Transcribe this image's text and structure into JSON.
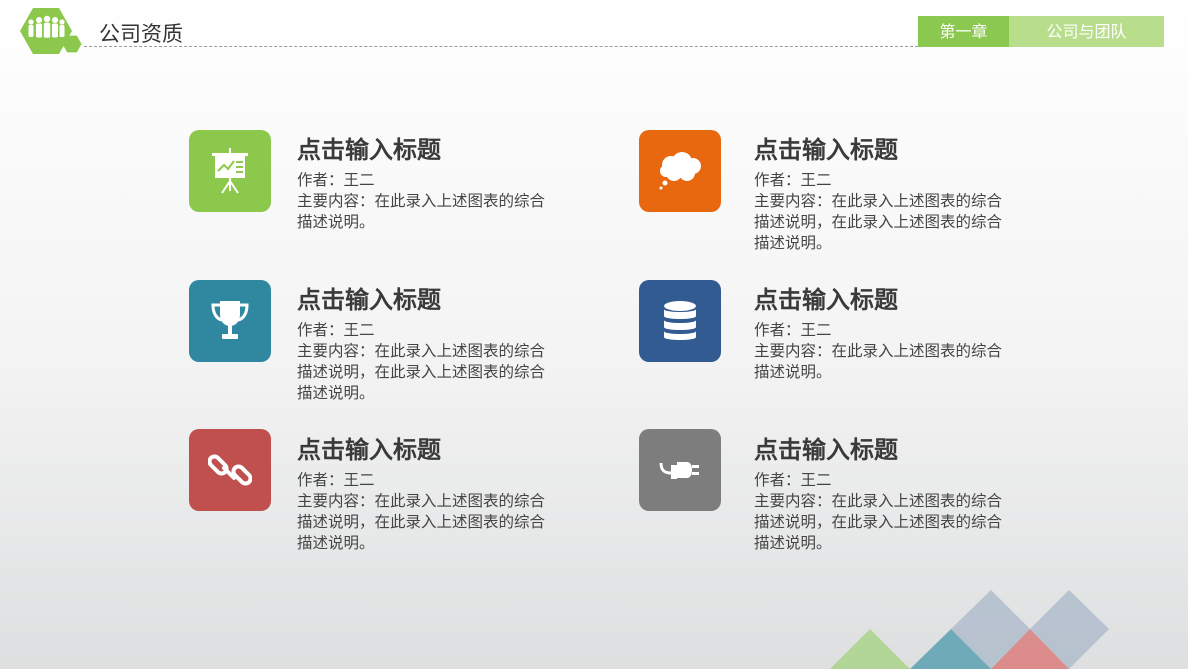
{
  "header": {
    "title": "公司资质",
    "chapter": "第一章",
    "chapter_name": "公司与团队"
  },
  "cards": [
    {
      "title": "点击输入标题",
      "author": "作者：王二",
      "desc": "主要内容：在此录入上述图表的综合描述说明。",
      "color": "#8cc84b",
      "icon": "presentation-board-icon"
    },
    {
      "title": "点击输入标题",
      "author": "作者：王二",
      "desc": "主要内容：在此录入上述图表的综合描述说明，在此录入上述图表的综合描述说明。",
      "color": "#e8680f",
      "icon": "thought-bubble-icon"
    },
    {
      "title": "点击输入标题",
      "author": "作者：王二",
      "desc": "主要内容：在此录入上述图表的综合描述说明，在此录入上述图表的综合描述说明。",
      "color": "#2f87a0",
      "icon": "trophy-icon"
    },
    {
      "title": "点击输入标题",
      "author": "作者：王二",
      "desc": "主要内容：在此录入上述图表的综合描述说明。",
      "color": "#325b91",
      "icon": "database-icon"
    },
    {
      "title": "点击输入标题",
      "author": "作者：王二",
      "desc": "主要内容：在此录入上述图表的综合描述说明，在此录入上述图表的综合描述说明。",
      "color": "#c0504d",
      "icon": "link-icon"
    },
    {
      "title": "点击输入标题",
      "author": "作者：王二",
      "desc": "主要内容：在此录入上述图表的综合描述说明，在此录入上述图表的综合描述说明。",
      "color": "#7d7d7d",
      "icon": "plug-icon"
    }
  ]
}
